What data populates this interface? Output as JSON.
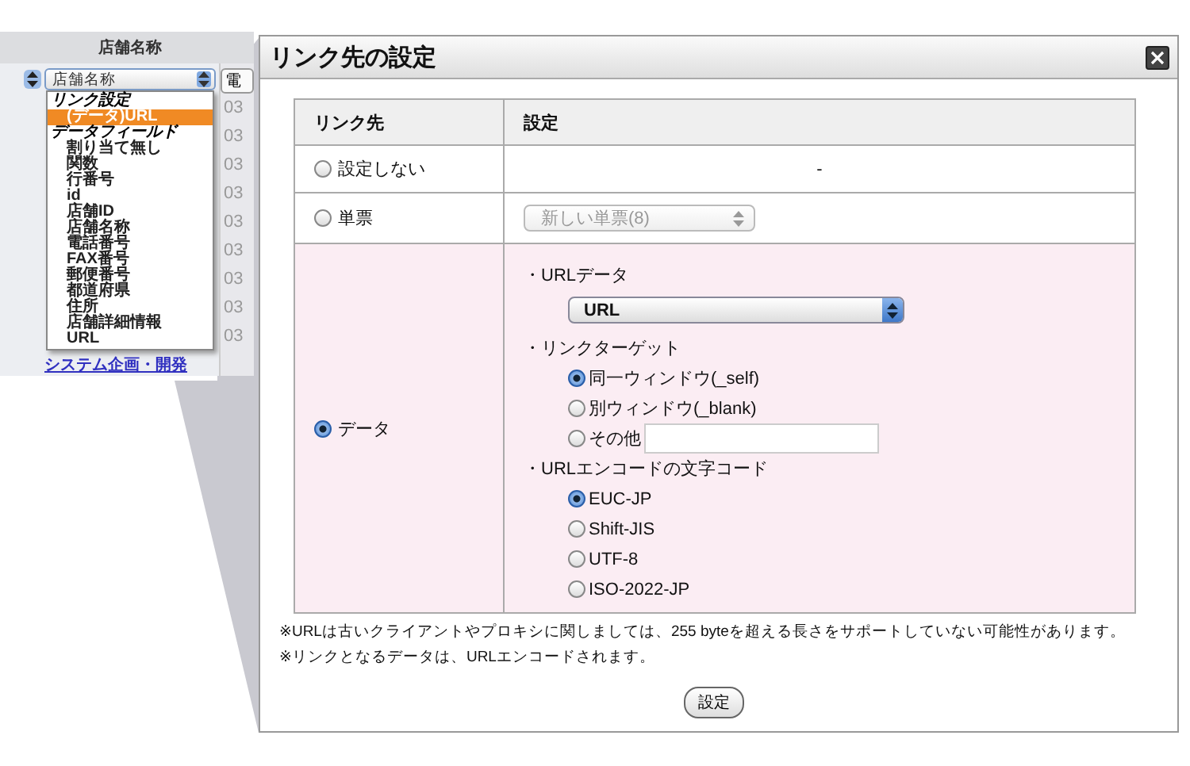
{
  "spreadsheet": {
    "column_header": "店舗名称",
    "column_select": "店舗名称",
    "next_column_header": "電",
    "link": "システム企画・開発",
    "column_values": [
      "03",
      "03",
      "03",
      "03",
      "03",
      "03",
      "03",
      "03",
      "03"
    ]
  },
  "field_menu": {
    "groups": [
      {
        "label": "リンク設定",
        "items": [
          {
            "label": "(データ)URL",
            "selected": true
          }
        ]
      },
      {
        "label": "データフィールド",
        "items": [
          {
            "label": "割り当て無し",
            "selected": false
          },
          {
            "label": "関数",
            "selected": false
          },
          {
            "label": "行番号",
            "selected": false
          },
          {
            "label": "id",
            "selected": false
          },
          {
            "label": "店舗ID",
            "selected": false
          },
          {
            "label": "店舗名称",
            "selected": false
          },
          {
            "label": "電話番号",
            "selected": false
          },
          {
            "label": "FAX番号",
            "selected": false
          },
          {
            "label": "郵便番号",
            "selected": false
          },
          {
            "label": "都道府県",
            "selected": false
          },
          {
            "label": "住所",
            "selected": false
          },
          {
            "label": "店舗詳細情報",
            "selected": false
          },
          {
            "label": "URL",
            "selected": false
          }
        ]
      }
    ]
  },
  "dialog": {
    "title": "リンク先の設定",
    "table": {
      "columns": [
        "リンク先",
        "設定"
      ],
      "rows": [
        {
          "kind": "text",
          "label": "設定しない",
          "selected": false,
          "value": "-"
        },
        {
          "kind": "select",
          "label": "単票",
          "selected": false,
          "select": {
            "value": "新しい単票(8)",
            "disabled": true
          }
        },
        {
          "kind": "sections",
          "label": "データ",
          "selected": true,
          "sections": [
            {
              "kind": "select",
              "heading": "・URLデータ",
              "value": "URL"
            },
            {
              "kind": "radios",
              "heading": "・リンクターゲット",
              "options": [
                {
                  "kind": "plain",
                  "label": "同一ウィンドウ(_self)",
                  "selected": true
                },
                {
                  "kind": "plain",
                  "label": "別ウィンドウ(_blank)",
                  "selected": false
                },
                {
                  "kind": "text-input",
                  "label": "その他",
                  "selected": false
                }
              ]
            },
            {
              "kind": "radios",
              "heading": "・URLエンコードの文字コード",
              "options": [
                {
                  "kind": "plain",
                  "label": "EUC-JP",
                  "selected": true
                },
                {
                  "kind": "plain",
                  "label": "Shift-JIS",
                  "selected": false
                },
                {
                  "kind": "plain",
                  "label": "UTF-8",
                  "selected": false
                },
                {
                  "kind": "plain",
                  "label": "ISO-2022-JP",
                  "selected": false
                }
              ]
            }
          ]
        }
      ]
    },
    "notes": [
      "※URLは古いクライアントやプロキシに関しましては、255 byteを超える長さをサポートしていない可能性があります。",
      "※リンクとなるデータは、URLエンコードされます。"
    ],
    "button": "設定"
  }
}
